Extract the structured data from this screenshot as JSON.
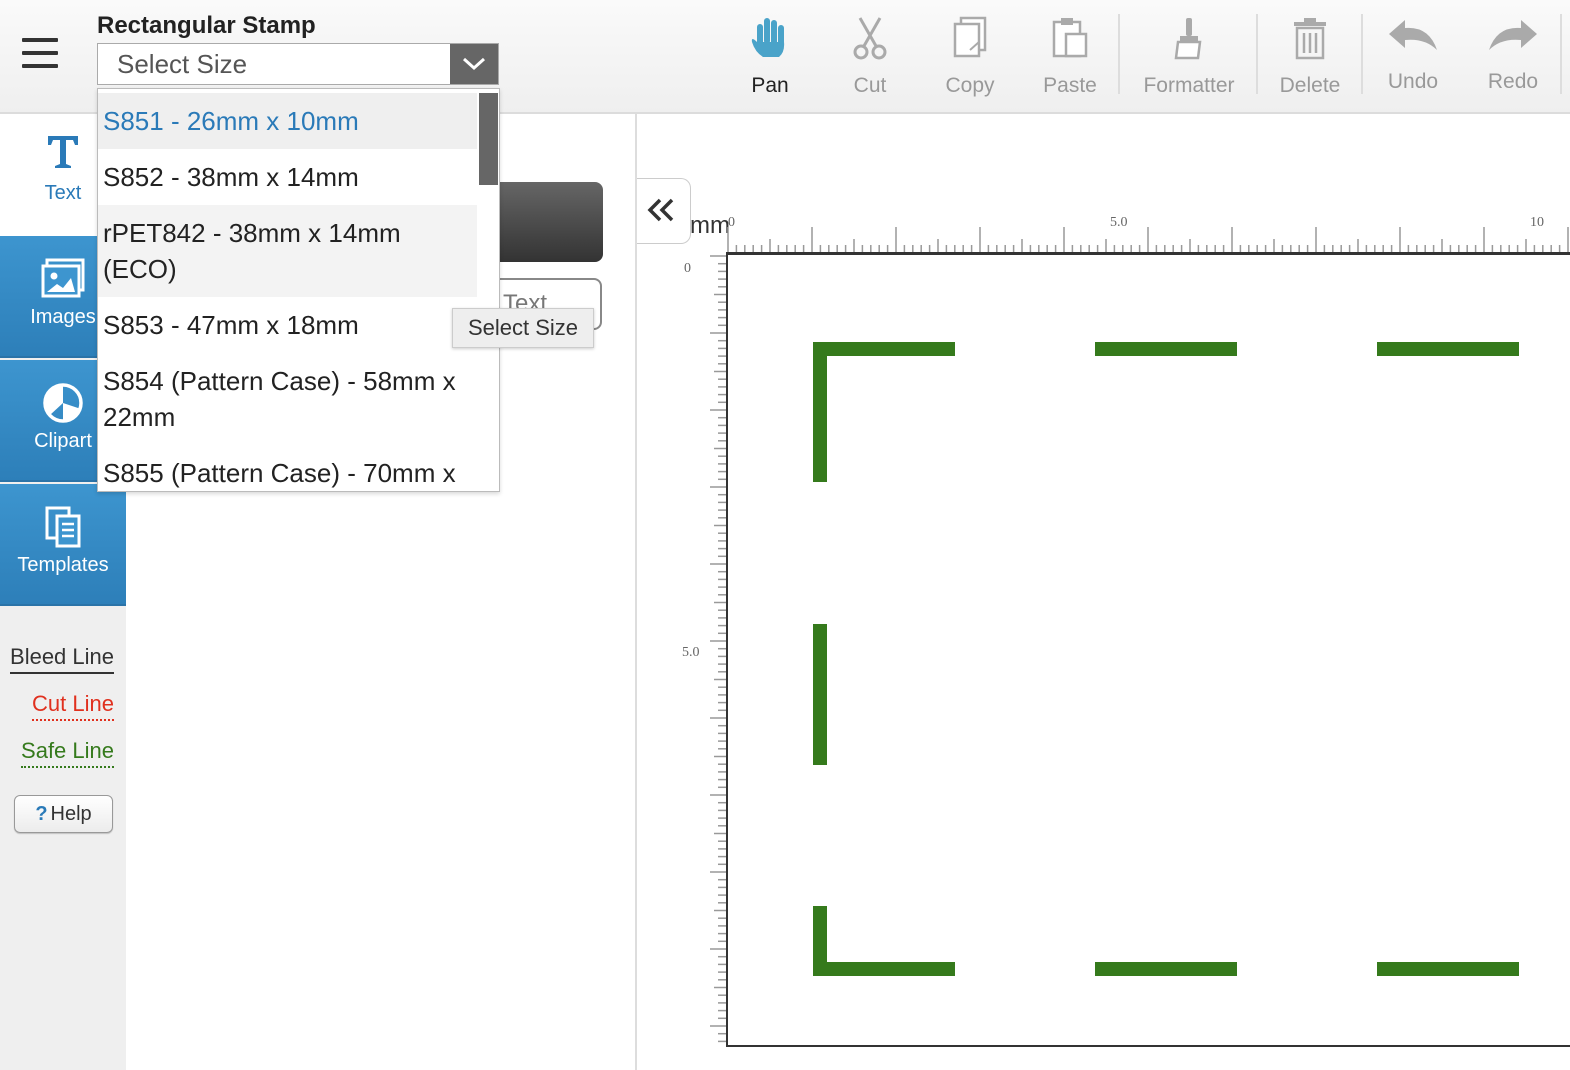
{
  "header": {
    "product_title": "Rectangular Stamp",
    "size_select": {
      "value": "Select Size"
    }
  },
  "toolbar": {
    "pan": "Pan",
    "cut": "Cut",
    "copy": "Copy",
    "paste": "Paste",
    "formatter": "Formatter",
    "delete": "Delete",
    "undo": "Undo",
    "redo": "Redo"
  },
  "size_options": [
    {
      "label": "S851 - 26mm x 10mm",
      "highlighted": true
    },
    {
      "label": "S852 - 38mm x 14mm"
    },
    {
      "label": "rPET842 - 38mm x 14mm (ECO)"
    },
    {
      "label": "S853 - 47mm x 18mm"
    },
    {
      "label": "S854 (Pattern Case) - 58mm x 22mm"
    },
    {
      "label": "S855 (Pattern Case) - 70mm x"
    }
  ],
  "tooltip": "Select Size",
  "sidebar": {
    "tabs": [
      {
        "label": "Text",
        "icon": "text-icon"
      },
      {
        "label": "Images",
        "icon": "images-icon"
      },
      {
        "label": "Clipart",
        "icon": "clipart-icon"
      },
      {
        "label": "Templates",
        "icon": "templates-icon"
      }
    ],
    "guides": {
      "bleed": "Bleed Line",
      "cut": "Cut Line",
      "safe": "Safe Line"
    },
    "help": "Help"
  },
  "panel": {
    "text_button_label": "Text"
  },
  "canvas": {
    "unit": "mm",
    "ruler_h_labels": [
      "0",
      "5.0",
      "10"
    ],
    "ruler_v_labels": [
      "0",
      "5.0"
    ]
  },
  "colors": {
    "accent": "#2a7ab8",
    "safe_line": "#357a1c",
    "cut_line": "#e0301e",
    "pan_icon": "#4aa3c9"
  }
}
